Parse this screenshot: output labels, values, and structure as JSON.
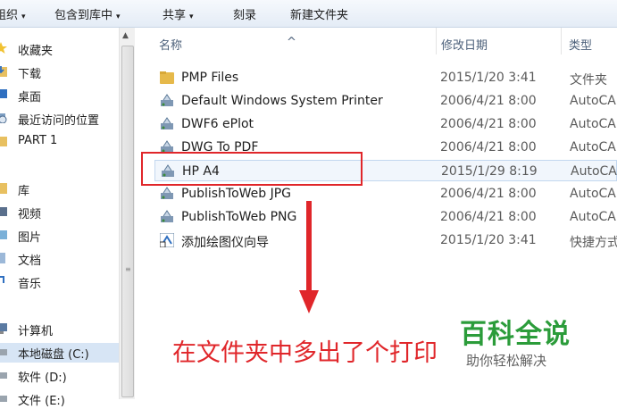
{
  "toolbar": {
    "items": [
      {
        "label": "组织",
        "has_arrow": true
      },
      {
        "label": "包含到库中",
        "has_arrow": true
      },
      {
        "label": "共享",
        "has_arrow": true
      },
      {
        "label": "刻录",
        "has_arrow": false
      },
      {
        "label": "新建文件夹",
        "has_arrow": false
      }
    ],
    "arrow_glyph": "▾"
  },
  "nav": {
    "favorites": {
      "label": "收藏夹",
      "icon": "star-icon"
    },
    "favorite_items": [
      {
        "label": "下载",
        "icon": "download-folder-icon"
      },
      {
        "label": "桌面",
        "icon": "desktop-icon"
      },
      {
        "label": "最近访问的位置",
        "icon": "recent-places-icon"
      },
      {
        "label": "PART 1",
        "icon": "folder-icon"
      }
    ],
    "libraries": {
      "label": "库",
      "icon": "library-icon"
    },
    "library_items": [
      {
        "label": "视频",
        "icon": "video-icon"
      },
      {
        "label": "图片",
        "icon": "pictures-icon"
      },
      {
        "label": "文档",
        "icon": "documents-icon"
      },
      {
        "label": "音乐",
        "icon": "music-icon"
      }
    ],
    "computer": {
      "label": "计算机",
      "icon": "computer-icon"
    },
    "computer_items": [
      {
        "label": "本地磁盘 (C:)",
        "icon": "drive-icon"
      },
      {
        "label": "软件 (D:)",
        "icon": "drive-icon"
      },
      {
        "label": "文件 (E:)",
        "icon": "drive-icon"
      }
    ]
  },
  "columns": {
    "name": "名称",
    "date": "修改日期",
    "type": "类型"
  },
  "files": [
    {
      "name": "PMP Files",
      "date": "2015/1/20 3:41",
      "type": "文件夹",
      "icon": "folder-icon"
    },
    {
      "name": "Default Windows System Printer",
      "date": "2006/4/21 8:00",
      "type": "AutoCA",
      "icon": "plotter-icon"
    },
    {
      "name": "DWF6 ePlot",
      "date": "2006/4/21 8:00",
      "type": "AutoCA",
      "icon": "plotter-icon"
    },
    {
      "name": "DWG To PDF",
      "date": "2006/4/21 8:00",
      "type": "AutoCA",
      "icon": "plotter-icon"
    },
    {
      "name": "HP A4",
      "date": "2015/1/29 8:19",
      "type": "AutoCA",
      "icon": "plotter-icon"
    },
    {
      "name": "PublishToWeb JPG",
      "date": "2006/4/21 8:00",
      "type": "AutoCA",
      "icon": "plotter-icon"
    },
    {
      "name": "PublishToWeb PNG",
      "date": "2006/4/21 8:00",
      "type": "AutoCA",
      "icon": "plotter-icon"
    },
    {
      "name": "添加绘图仪向导",
      "date": "2015/1/20 3:41",
      "type": "快捷方式",
      "icon": "wizard-shortcut-icon"
    }
  ],
  "annotation": {
    "caption": "在文件夹中多出了个打印",
    "color": "#e0262a"
  },
  "watermark": {
    "title": "百科全说",
    "subtitle": "助你轻松解决",
    "color": "#2b9c3a"
  }
}
